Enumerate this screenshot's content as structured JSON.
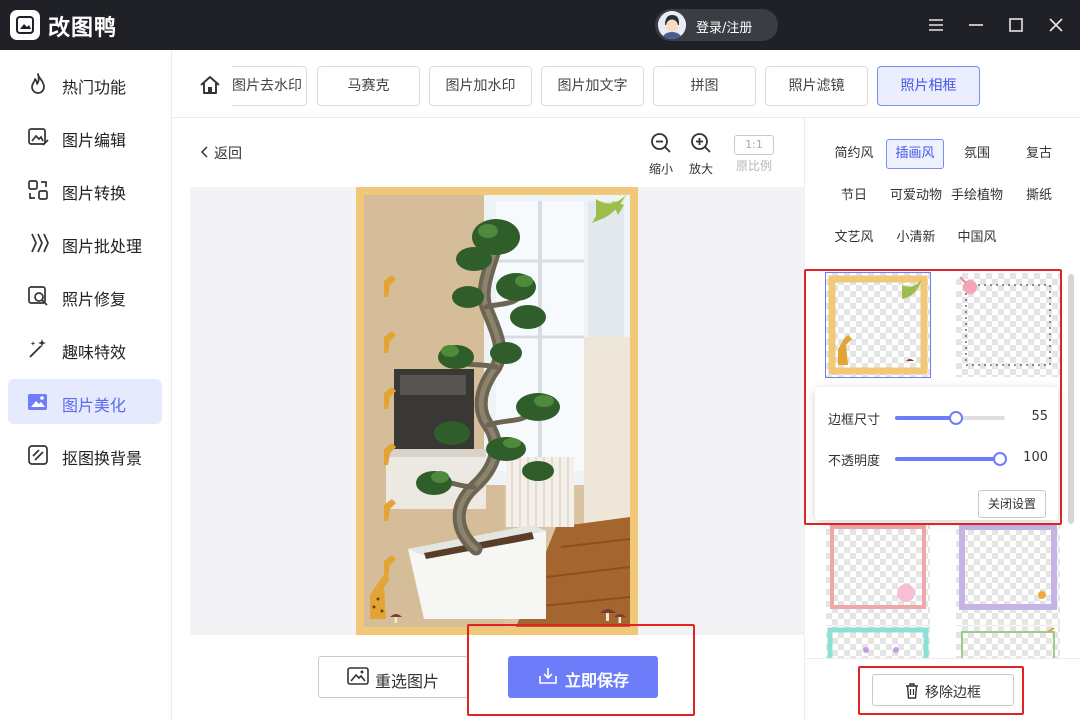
{
  "app": {
    "name": "改图鸭",
    "login_label": "登录/注册"
  },
  "window_controls": {
    "menu": "menu-icon",
    "minimize": "minimize-icon",
    "maximize": "maximize-icon",
    "close": "close-icon"
  },
  "sidebar": {
    "items": [
      {
        "label": "热门功能",
        "icon": "flame-icon",
        "active": false
      },
      {
        "label": "图片编辑",
        "icon": "image-edit-icon",
        "active": false
      },
      {
        "label": "图片转换",
        "icon": "convert-icon",
        "active": false
      },
      {
        "label": "图片批处理",
        "icon": "batch-icon",
        "active": false
      },
      {
        "label": "照片修复",
        "icon": "photo-repair-icon",
        "active": false
      },
      {
        "label": "趣味特效",
        "icon": "magic-wand-icon",
        "active": false
      },
      {
        "label": "图片美化",
        "icon": "beautify-icon",
        "active": true
      },
      {
        "label": "抠图换背景",
        "icon": "cutout-icon",
        "active": false
      }
    ]
  },
  "tabs": {
    "items": [
      {
        "label": "图片去水印",
        "active": false
      },
      {
        "label": "马赛克",
        "active": false
      },
      {
        "label": "图片加水印",
        "active": false
      },
      {
        "label": "图片加文字",
        "active": false
      },
      {
        "label": "拼图",
        "active": false
      },
      {
        "label": "照片滤镜",
        "active": false
      },
      {
        "label": "照片相框",
        "active": true
      }
    ]
  },
  "editor": {
    "back_label": "返回",
    "zoom_out_label": "缩小",
    "zoom_in_label": "放大",
    "ratio_label": "原比例",
    "ratio_value": "1:1",
    "reselect_label": "重选图片",
    "save_label": "立即保存"
  },
  "frame_panel": {
    "style_tags": [
      {
        "label": "简约风",
        "active": false
      },
      {
        "label": "插画风",
        "active": true
      },
      {
        "label": "氛围",
        "active": false
      },
      {
        "label": "复古",
        "active": false
      },
      {
        "label": "节日",
        "active": false
      },
      {
        "label": "可爱动物",
        "active": false
      },
      {
        "label": "手绘植物",
        "active": false
      },
      {
        "label": "撕纸",
        "active": false
      },
      {
        "label": "文艺风",
        "active": false
      },
      {
        "label": "小清新",
        "active": false
      },
      {
        "label": "中国风",
        "active": false
      }
    ],
    "settings": {
      "border_size_label": "边框尺寸",
      "border_size_value": "55",
      "border_size_fraction": 0.55,
      "opacity_label": "不透明度",
      "opacity_value": "100",
      "opacity_fraction": 1.0,
      "close_label": "关闭设置"
    },
    "remove_label": "移除边框"
  },
  "colors": {
    "accent": "#6d7dfa",
    "highlight": "#e02424",
    "titlebar": "#1f2126",
    "frame_gold": "#f0c878"
  }
}
